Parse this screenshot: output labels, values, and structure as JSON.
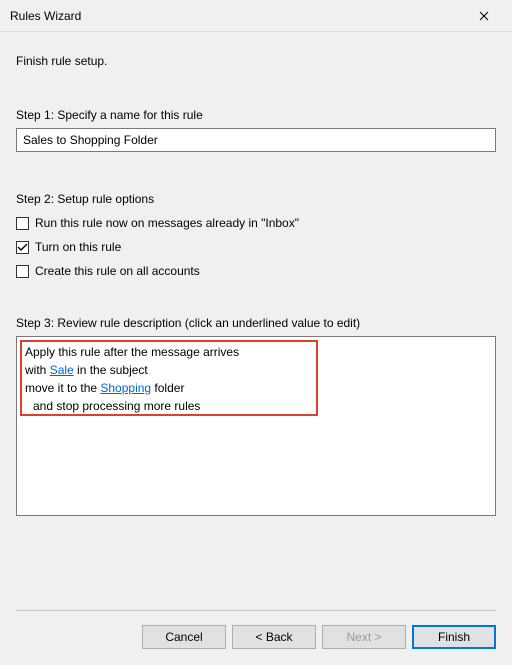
{
  "window": {
    "title": "Rules Wizard"
  },
  "intro": "Finish rule setup.",
  "step1": {
    "label": "Step 1: Specify a name for this rule",
    "value": "Sales to Shopping Folder"
  },
  "step2": {
    "label": "Step 2: Setup rule options",
    "opt_run_now": {
      "label": "Run this rule now on messages already in \"Inbox\"",
      "checked": false
    },
    "opt_turn_on": {
      "label": "Turn on this rule",
      "checked": true
    },
    "opt_all_accounts": {
      "label": "Create this rule on all accounts",
      "checked": false
    }
  },
  "step3": {
    "label": "Step 3: Review rule description (click an underlined value to edit)",
    "line1": "Apply this rule after the message arrives",
    "line2_pre": "with ",
    "line2_link": "Sale",
    "line2_post": " in the subject",
    "line3_pre": "move it to the ",
    "line3_link": "Shopping",
    "line3_post": " folder",
    "line4": "and stop processing more rules"
  },
  "buttons": {
    "cancel": "Cancel",
    "back": "< Back",
    "next": "Next >",
    "finish": "Finish"
  }
}
